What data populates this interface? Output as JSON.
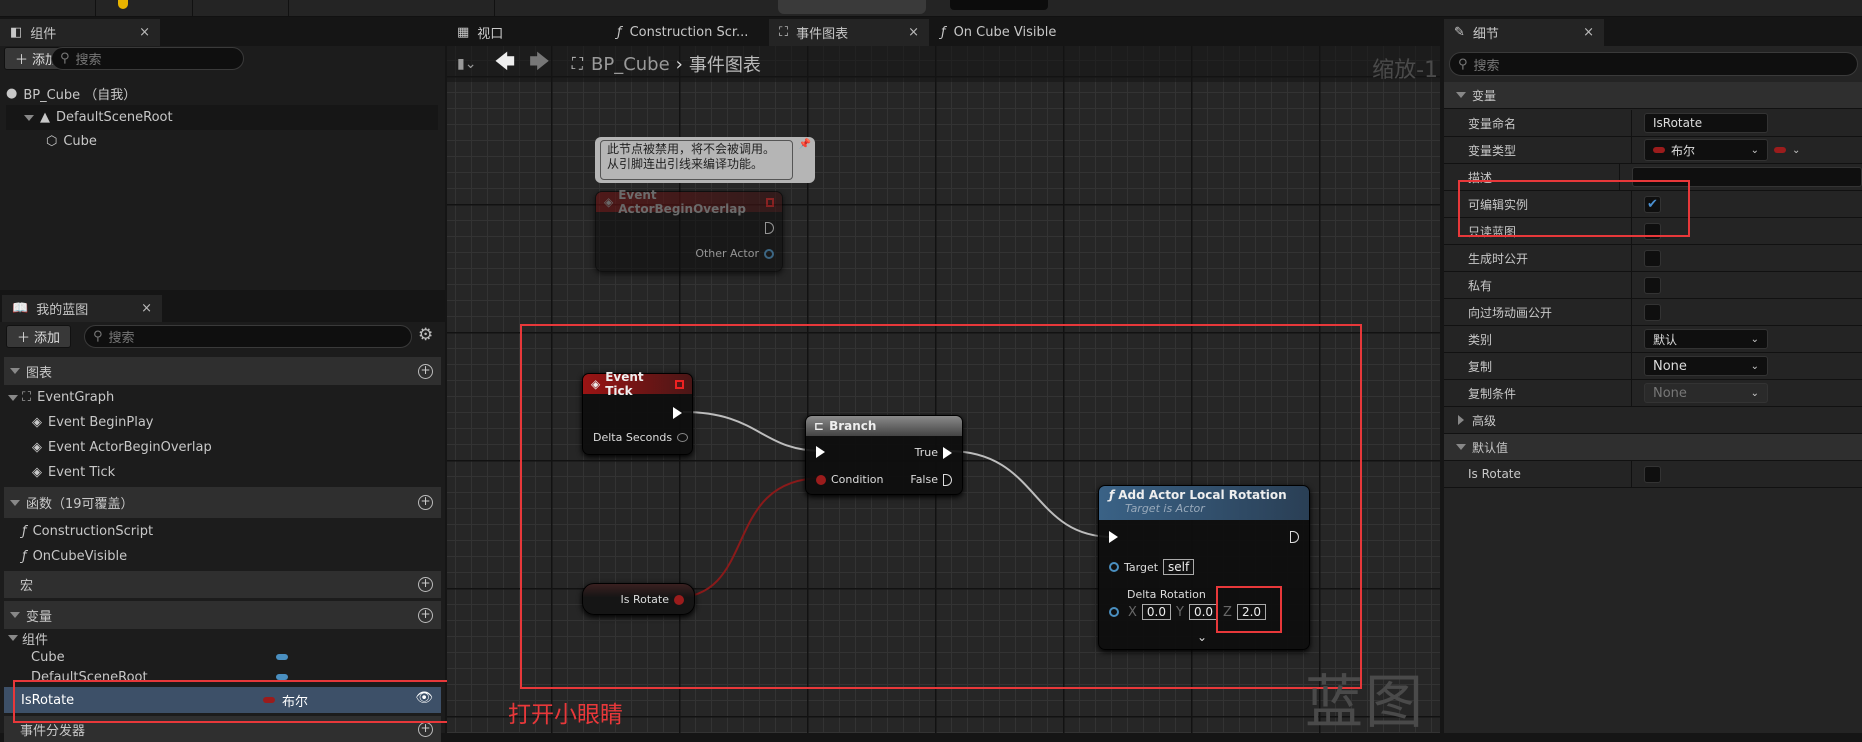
{
  "colors": {
    "exec": "#ffffff",
    "bool": "#9b1c1c",
    "object": "#4a8fc0",
    "highlight": "#e8383a",
    "event_header": "#8a1414",
    "function_header": "#3a5e80",
    "selected_row": "#3d5068"
  },
  "components_panel": {
    "tab": "组件",
    "close": "×",
    "add_label": "添加",
    "search_placeholder": "搜索",
    "tree": [
      {
        "label": "BP_Cube （自我）",
        "icon": "actor-icon"
      },
      {
        "label": "DefaultSceneRoot",
        "icon": "scene-root-icon"
      },
      {
        "label": "Cube",
        "icon": "cube-icon"
      }
    ]
  },
  "my_blueprint": {
    "tab": "我的蓝图",
    "close": "×",
    "add_label": "添加",
    "search_placeholder": "搜索",
    "graphs_header": "图表",
    "event_graph": "EventGraph",
    "events": [
      "Event BeginPlay",
      "Event ActorBeginOverlap",
      "Event Tick"
    ],
    "functions_header": "函数（19可覆盖）",
    "functions": [
      "ConstructionScript",
      "OnCubeVisible"
    ],
    "macros_header": "宏",
    "variables_header": "变量",
    "components_group": "组件",
    "variables": [
      {
        "name": "Cube",
        "type": ""
      },
      {
        "name": "DefaultSceneRoot",
        "type": ""
      }
    ],
    "selected_variable": {
      "name": "IsRotate",
      "type": "布尔",
      "visible": true
    },
    "dispatchers_header": "事件分发器"
  },
  "annotation_text": "打开小眼睛",
  "editor_tabs": [
    {
      "label": "视口",
      "icon": "viewport-icon"
    },
    {
      "label": "Construction Scr...",
      "icon": "function-icon"
    },
    {
      "label": "事件图表",
      "icon": "graph-icon",
      "active": true,
      "close": "×"
    },
    {
      "label": "On Cube Visible",
      "icon": "function-icon"
    }
  ],
  "breadcrumb": {
    "root": "BP_Cube",
    "separator": "›",
    "current": "事件图表"
  },
  "zoom_label": "缩放-1",
  "watermark": "蓝图",
  "graph": {
    "comment": "此节点被禁用，将不会被调用。\n从引脚连出引线来编译功能。",
    "disabled_node": {
      "title": "Event ActorBeginOverlap",
      "pin": "Other Actor"
    },
    "event_tick": {
      "title": "Event Tick",
      "pin": "Delta Seconds"
    },
    "branch": {
      "title": "Branch",
      "condition": "Condition",
      "true": "True",
      "false": "False"
    },
    "getter": {
      "label": "Is Rotate"
    },
    "add_rotation": {
      "title": "Add Actor Local Rotation",
      "subtitle": "Target is Actor",
      "target_label": "Target",
      "target_value": "self",
      "delta_label": "Delta Rotation",
      "x_label": "X",
      "x": "0.0",
      "y_label": "Y",
      "y": "0.0",
      "z_label": "Z",
      "z": "2.0"
    }
  },
  "details": {
    "tab": "细节",
    "close": "×",
    "search_placeholder": "搜索",
    "variable_header": "变量",
    "rows": {
      "name_label": "变量命名",
      "name_value": "IsRotate",
      "type_label": "变量类型",
      "type_value": "布尔",
      "desc_label": "描述",
      "instance_editable_label": "可编辑实例",
      "instance_editable": true,
      "readonly_label": "只读蓝图",
      "readonly": false,
      "expose_spawn_label": "生成时公开",
      "expose_spawn": false,
      "private_label": "私有",
      "private": false,
      "expose_cine_label": "向过场动画公开",
      "expose_cine": false,
      "category_label": "类别",
      "category_value": "默认",
      "replication_label": "复制",
      "replication_value": "None",
      "rep_cond_label": "复制条件",
      "rep_cond_value": "None"
    },
    "advanced_header": "高级",
    "default_header": "默认值",
    "default_label": "Is Rotate",
    "default_value": false
  }
}
